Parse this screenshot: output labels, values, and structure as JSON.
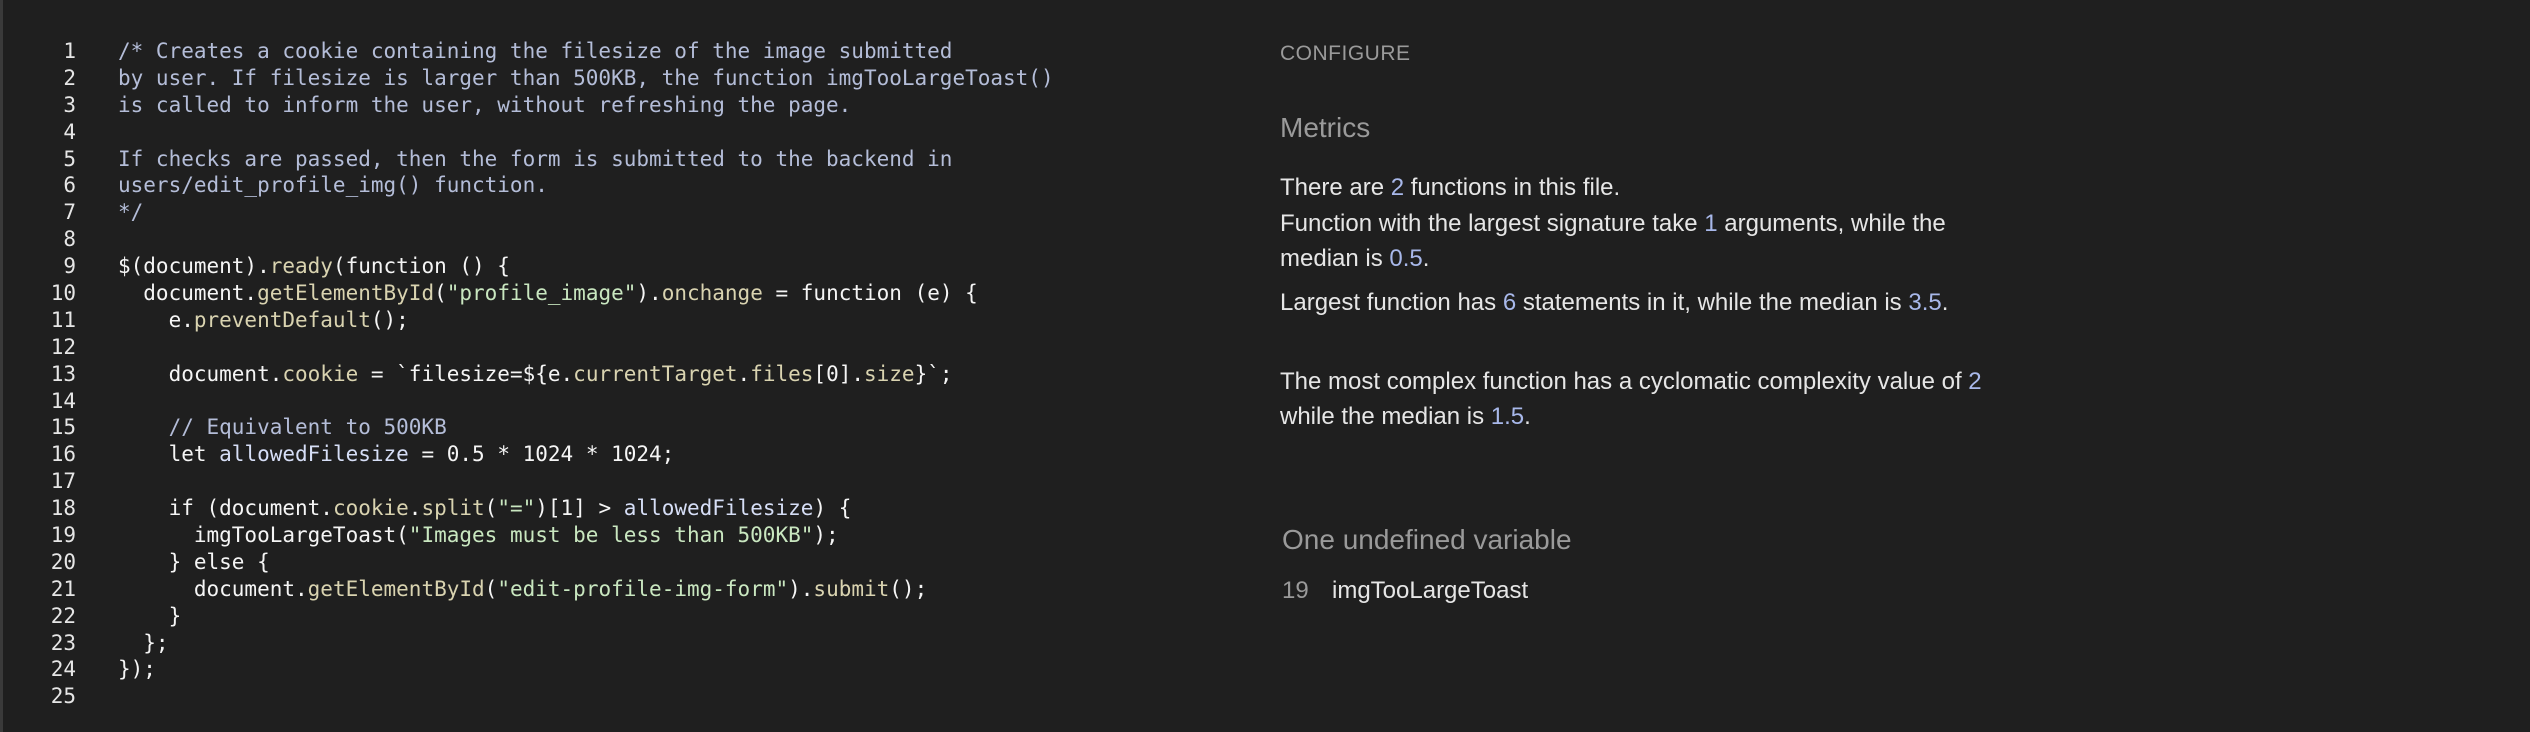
{
  "editor": {
    "lines": [
      {
        "n": "1",
        "segments": [
          {
            "t": "/* Creates a cookie containing the filesize of the image submitted",
            "c": "comment"
          }
        ]
      },
      {
        "n": "2",
        "segments": [
          {
            "t": "by user. If filesize is larger than 500KB, the function imgTooLargeToast()",
            "c": "comment"
          }
        ]
      },
      {
        "n": "3",
        "segments": [
          {
            "t": "is called to inform the user, without refreshing the page.",
            "c": "comment"
          }
        ]
      },
      {
        "n": "4",
        "segments": []
      },
      {
        "n": "5",
        "segments": [
          {
            "t": "If checks are passed, then the form is submitted to the backend in",
            "c": "comment"
          }
        ]
      },
      {
        "n": "6",
        "segments": [
          {
            "t": "users/edit_profile_img() function.",
            "c": "comment"
          }
        ]
      },
      {
        "n": "7",
        "segments": [
          {
            "t": "*/",
            "c": "comment"
          }
        ]
      },
      {
        "n": "8",
        "segments": []
      },
      {
        "n": "9",
        "segments": [
          {
            "t": "$(document).",
            "c": ""
          },
          {
            "t": "ready",
            "c": "prop"
          },
          {
            "t": "(function () {",
            "c": ""
          }
        ]
      },
      {
        "n": "10",
        "segments": [
          {
            "t": "  document.",
            "c": ""
          },
          {
            "t": "getElementById",
            "c": "prop"
          },
          {
            "t": "(",
            "c": ""
          },
          {
            "t": "\"profile_image\"",
            "c": "string"
          },
          {
            "t": ").",
            "c": ""
          },
          {
            "t": "onchange",
            "c": "prop"
          },
          {
            "t": " = function (e) {",
            "c": ""
          }
        ]
      },
      {
        "n": "11",
        "segments": [
          {
            "t": "    e.",
            "c": ""
          },
          {
            "t": "preventDefault",
            "c": "prop"
          },
          {
            "t": "();",
            "c": ""
          }
        ]
      },
      {
        "n": "12",
        "segments": []
      },
      {
        "n": "13",
        "segments": [
          {
            "t": "    document.",
            "c": ""
          },
          {
            "t": "cookie",
            "c": "prop"
          },
          {
            "t": " = `filesize=${e.",
            "c": ""
          },
          {
            "t": "currentTarget",
            "c": "prop"
          },
          {
            "t": ".",
            "c": ""
          },
          {
            "t": "files",
            "c": "prop"
          },
          {
            "t": "[0].",
            "c": ""
          },
          {
            "t": "size",
            "c": "prop"
          },
          {
            "t": "}`;",
            "c": ""
          }
        ]
      },
      {
        "n": "14",
        "segments": []
      },
      {
        "n": "15",
        "segments": [
          {
            "t": "    // Equivalent to 500KB",
            "c": "comment"
          }
        ]
      },
      {
        "n": "16",
        "segments": [
          {
            "t": "    let ",
            "c": ""
          },
          {
            "t": "allowedFilesize",
            "c": "var"
          },
          {
            "t": " = 0.5 * 1024 * 1024;",
            "c": ""
          }
        ]
      },
      {
        "n": "17",
        "segments": []
      },
      {
        "n": "18",
        "segments": [
          {
            "t": "    if (document.",
            "c": ""
          },
          {
            "t": "cookie",
            "c": "prop"
          },
          {
            "t": ".",
            "c": ""
          },
          {
            "t": "split",
            "c": "prop"
          },
          {
            "t": "(",
            "c": ""
          },
          {
            "t": "\"=\"",
            "c": "string"
          },
          {
            "t": ")[1] > ",
            "c": ""
          },
          {
            "t": "allowedFilesize",
            "c": "var"
          },
          {
            "t": ") {",
            "c": ""
          }
        ]
      },
      {
        "n": "19",
        "segments": [
          {
            "t": "      imgTooLargeToast(",
            "c": ""
          },
          {
            "t": "\"Images must be less than 500KB\"",
            "c": "string"
          },
          {
            "t": ");",
            "c": ""
          }
        ]
      },
      {
        "n": "20",
        "segments": [
          {
            "t": "    } else {",
            "c": ""
          }
        ]
      },
      {
        "n": "21",
        "segments": [
          {
            "t": "      document.",
            "c": ""
          },
          {
            "t": "getElementById",
            "c": "prop"
          },
          {
            "t": "(",
            "c": ""
          },
          {
            "t": "\"edit-profile-img-form\"",
            "c": "string"
          },
          {
            "t": ").",
            "c": ""
          },
          {
            "t": "submit",
            "c": "prop"
          },
          {
            "t": "();",
            "c": ""
          }
        ]
      },
      {
        "n": "22",
        "segments": [
          {
            "t": "    }",
            "c": ""
          }
        ]
      },
      {
        "n": "23",
        "segments": [
          {
            "t": "  };",
            "c": ""
          }
        ]
      },
      {
        "n": "24",
        "segments": [
          {
            "t": "});",
            "c": ""
          }
        ]
      },
      {
        "n": "25",
        "segments": []
      }
    ]
  },
  "panel": {
    "configure_label": "CONFIGURE",
    "metrics_heading": "Metrics",
    "metrics": [
      {
        "parts": [
          {
            "t": "There are "
          },
          {
            "t": "2",
            "num": true
          },
          {
            "t": " functions in this file."
          }
        ]
      },
      {
        "parts": [
          {
            "t": "Function with the largest signature take "
          },
          {
            "t": "1",
            "num": true
          },
          {
            "t": " arguments, while the median is "
          },
          {
            "t": "0.5",
            "num": true
          },
          {
            "t": "."
          }
        ]
      },
      {
        "parts": [
          {
            "t": "Largest function has "
          },
          {
            "t": "6",
            "num": true
          },
          {
            "t": " statements in it, while the median is "
          },
          {
            "t": "3.5",
            "num": true
          },
          {
            "t": "."
          }
        ]
      },
      {
        "parts": [
          {
            "t": "The most complex function has a cyclomatic complexity value of "
          },
          {
            "t": "2",
            "num": true
          },
          {
            "t": " while the median is "
          },
          {
            "t": "1.5",
            "num": true
          },
          {
            "t": "."
          }
        ]
      }
    ],
    "undefined_heading": "One undefined variable",
    "undefined_vars": [
      {
        "line": "19",
        "name": "imgTooLargeToast"
      }
    ]
  }
}
